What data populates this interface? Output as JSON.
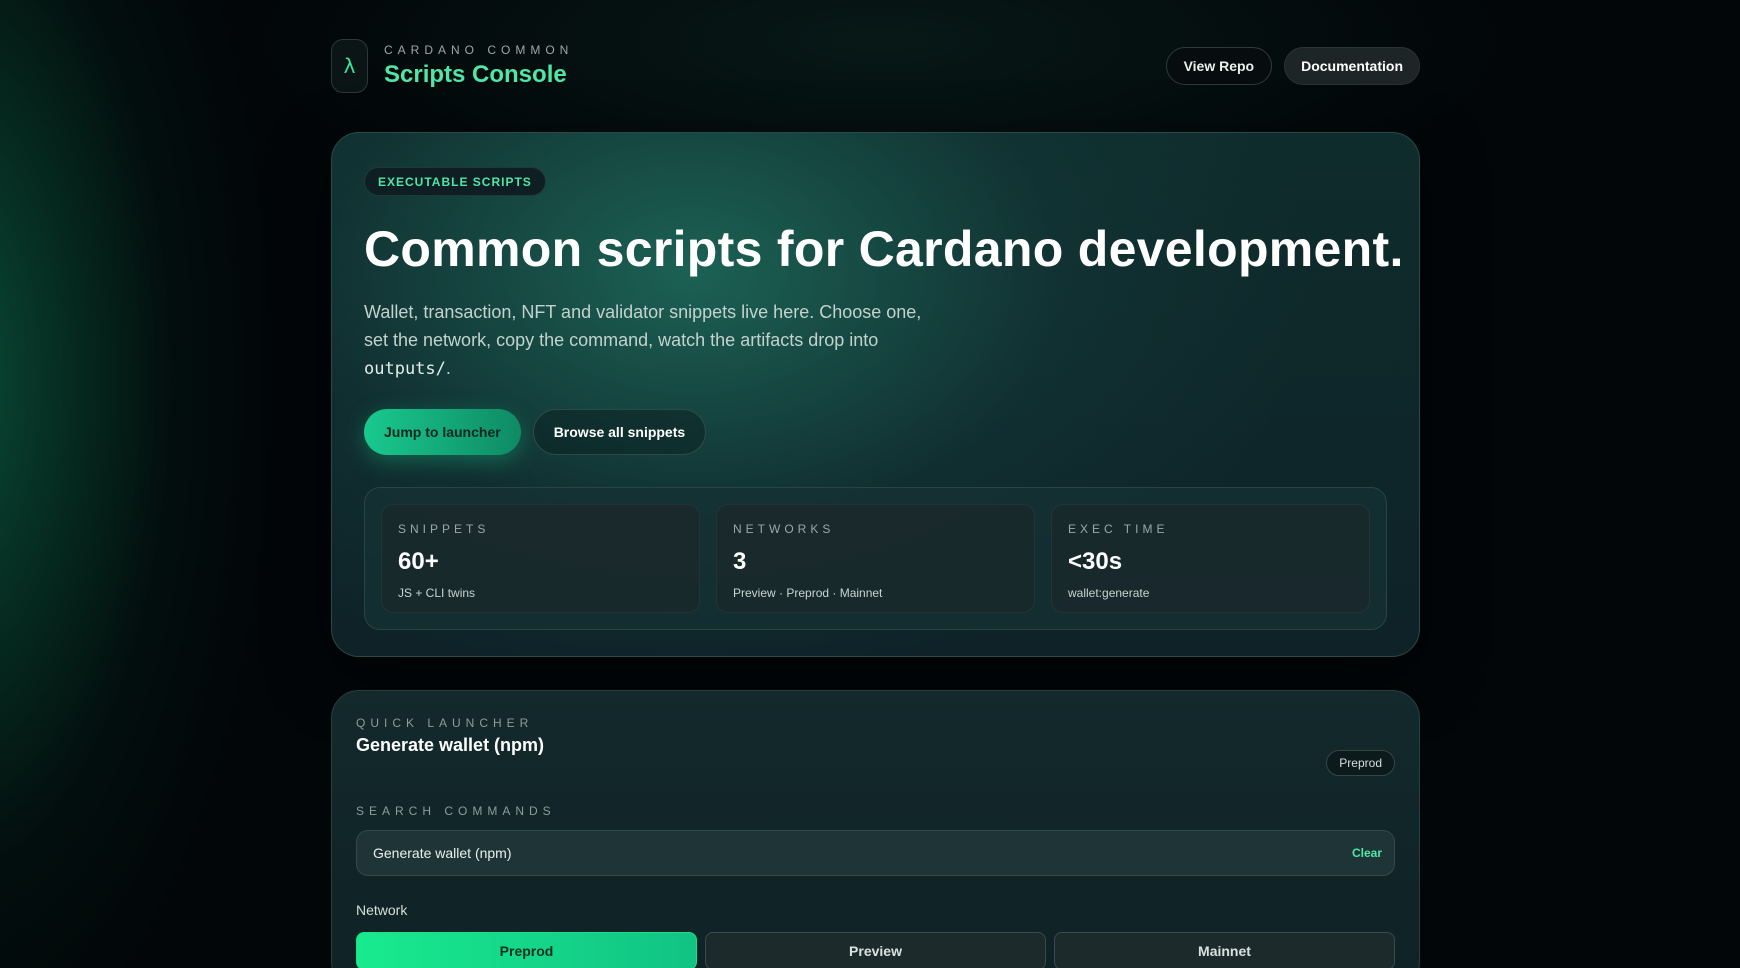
{
  "brand": {
    "logo_glyph": "λ",
    "eyebrow": "CARDANO COMMON",
    "title": "Scripts Console"
  },
  "header": {
    "view_repo": "View Repo",
    "documentation": "Documentation"
  },
  "hero": {
    "pill": "EXECUTABLE SCRIPTS",
    "title": "Common scripts for Cardano development.",
    "desc_before": "Wallet, transaction, NFT and validator snippets live here. Choose one, set the network, copy the command, watch the artifacts drop into ",
    "desc_code": "outputs/",
    "desc_after": ".",
    "primary_cta": "Jump to launcher",
    "secondary_cta": "Browse all snippets",
    "stats": [
      {
        "label": "SNIPPETS",
        "value": "60+",
        "sub": "JS + CLI twins"
      },
      {
        "label": "NETWORKS",
        "value": "3",
        "sub": "Preview · Preprod · Mainnet"
      },
      {
        "label": "EXEC TIME",
        "value": "<30s",
        "sub": "wallet:generate"
      }
    ]
  },
  "launcher": {
    "eyebrow": "QUICK LAUNCHER",
    "title": "Generate wallet (npm)",
    "network_badge": "Preprod",
    "search_label": "SEARCH COMMANDS",
    "search_value": "Generate wallet (npm)",
    "clear": "Clear",
    "network_label": "Network",
    "networks": [
      {
        "label": "Preprod",
        "active": true
      },
      {
        "label": "Preview",
        "active": false
      },
      {
        "label": "Mainnet",
        "active": false
      }
    ]
  },
  "colors": {
    "accent": "#4fe6a8",
    "background": "#020608",
    "active_tab": "#18ea8e"
  }
}
